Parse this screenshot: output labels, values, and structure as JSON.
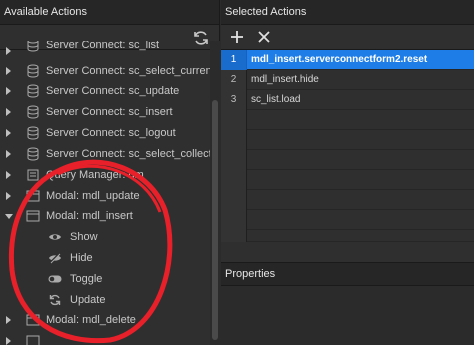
{
  "left_panel": {
    "title": "Available Actions",
    "refresh_icon": "refresh-icon",
    "tree": [
      {
        "label": "Server Connect: sc_list",
        "icon": "database-icon",
        "expandable": true
      },
      {
        "label": "Server Connect: sc_select_current",
        "icon": "database-icon",
        "expandable": true
      },
      {
        "label": "Server Connect: sc_update",
        "icon": "database-icon",
        "expandable": true
      },
      {
        "label": "Server Connect: sc_insert",
        "icon": "database-icon",
        "expandable": true
      },
      {
        "label": "Server Connect: sc_logout",
        "icon": "database-icon",
        "expandable": true
      },
      {
        "label": "Server Connect: sc_select_collection",
        "icon": "database-icon",
        "expandable": true
      },
      {
        "label": "Query Manager: qm",
        "icon": "query-icon",
        "expandable": true
      },
      {
        "label": "Modal: mdl_update",
        "icon": "modal-icon",
        "expandable": true
      },
      {
        "label": "Modal: mdl_insert",
        "icon": "modal-icon",
        "expandable": true,
        "expanded": true
      },
      {
        "label": "Show",
        "icon": "eye-icon",
        "child": true
      },
      {
        "label": "Hide",
        "icon": "eye-slash-icon",
        "child": true
      },
      {
        "label": "Toggle",
        "icon": "toggle-icon",
        "child": true
      },
      {
        "label": "Update",
        "icon": "refresh-icon",
        "child": true
      },
      {
        "label": "Modal: mdl_delete",
        "icon": "modal-icon",
        "expandable": true
      }
    ]
  },
  "right_panel": {
    "title": "Selected Actions",
    "add_icon": "plus-icon",
    "remove_icon": "close-icon",
    "selected": [
      {
        "num": "1",
        "text": "mdl_insert.serverconnectform2.reset",
        "active": true
      },
      {
        "num": "2",
        "text": "mdl_insert.hide",
        "active": false
      },
      {
        "num": "3",
        "text": "sc_list.load",
        "active": false
      }
    ],
    "properties_title": "Properties"
  },
  "colors": {
    "accent": "#1e7de6",
    "annotation": "#e8202a",
    "panel_bg": "#2f2f2f",
    "header_bg": "#262626"
  }
}
